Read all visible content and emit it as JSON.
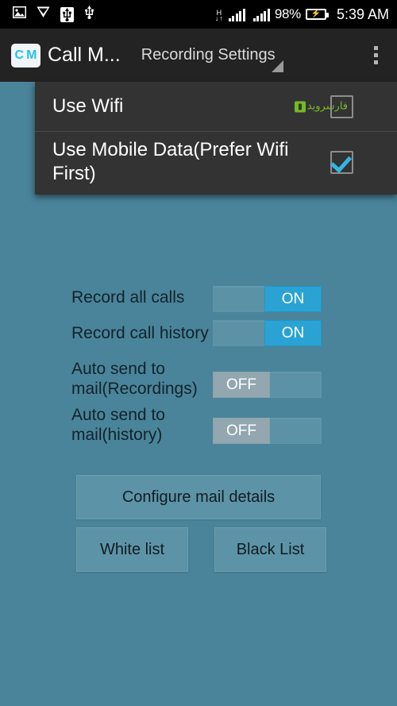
{
  "status_bar": {
    "icons": [
      "image-icon",
      "download-chevron-icon",
      "usb-connected-icon",
      "usb-icon"
    ],
    "network_type": "H",
    "battery_percent": "98%",
    "battery_state": "charging",
    "time": "5:39 AM",
    "signal_bars_1": [
      4,
      7,
      10,
      13,
      16
    ],
    "signal_bars_2": [
      4,
      7,
      10,
      13,
      16
    ]
  },
  "action_bar": {
    "logo_letters": [
      "C",
      "M"
    ],
    "app_title": "Call M...",
    "spinner_label": "Recording Settings",
    "overflow_label": "overflow-menu"
  },
  "dropdown": {
    "items": [
      {
        "label": "Use Wifi",
        "checked": false
      },
      {
        "label": "Use Mobile Data(Prefer Wifi First)",
        "checked": true
      }
    ],
    "watermark_text": "فارسروید"
  },
  "settings": {
    "rows": [
      {
        "label": "Record all calls",
        "state": "ON"
      },
      {
        "label": "Record call history",
        "state": "ON"
      },
      {
        "label": "Auto send to mail(Recordings)",
        "state": "OFF"
      },
      {
        "label": "Auto send to mail(history)",
        "state": "OFF"
      }
    ]
  },
  "buttons": {
    "configure_mail": "Configure mail details",
    "white_list": "White list",
    "black_list": "Black List"
  },
  "colors": {
    "background": "#4A849A",
    "action_bar": "#232323",
    "dropdown": "#333333",
    "toggle_on": "#2aa3d4",
    "toggle_off": "#92a7b0",
    "accent": "#24c4e8",
    "watermark_green": "#76b82a"
  }
}
